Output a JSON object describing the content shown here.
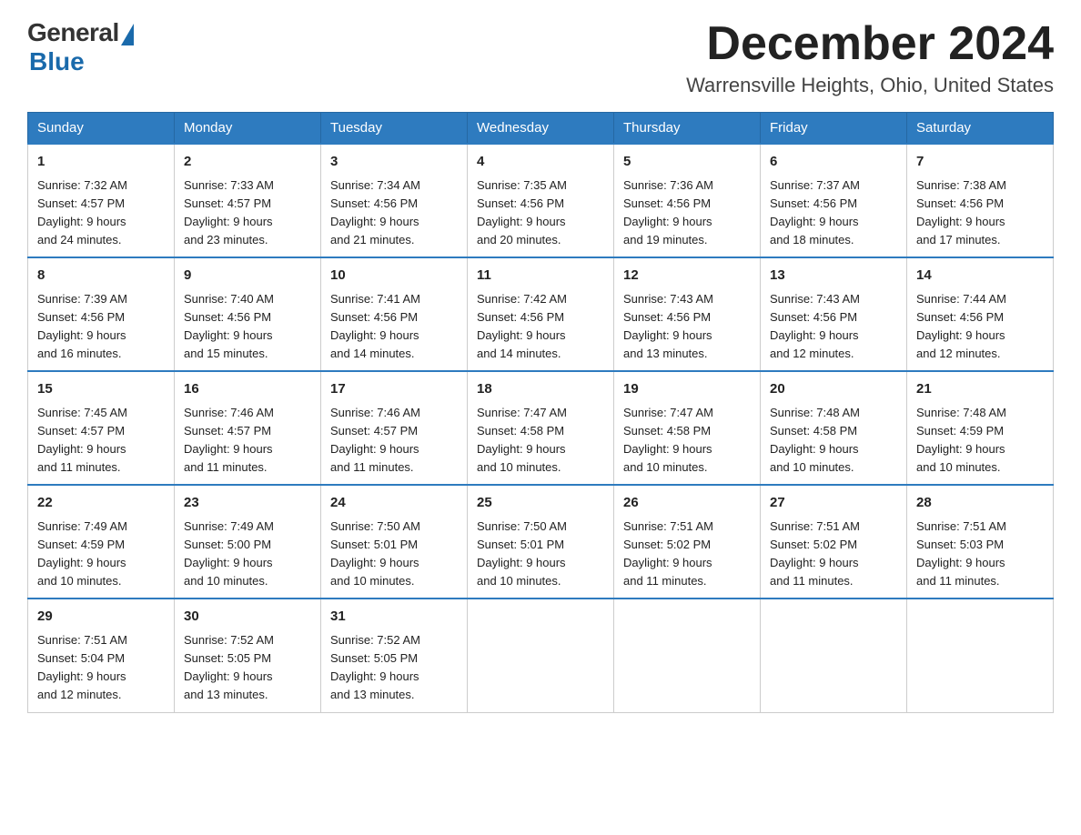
{
  "logo": {
    "general": "General",
    "blue": "Blue"
  },
  "title": "December 2024",
  "location": "Warrensville Heights, Ohio, United States",
  "days_of_week": [
    "Sunday",
    "Monday",
    "Tuesday",
    "Wednesday",
    "Thursday",
    "Friday",
    "Saturday"
  ],
  "weeks": [
    [
      {
        "day": "1",
        "sunrise": "7:32 AM",
        "sunset": "4:57 PM",
        "daylight": "9 hours and 24 minutes."
      },
      {
        "day": "2",
        "sunrise": "7:33 AM",
        "sunset": "4:57 PM",
        "daylight": "9 hours and 23 minutes."
      },
      {
        "day": "3",
        "sunrise": "7:34 AM",
        "sunset": "4:56 PM",
        "daylight": "9 hours and 21 minutes."
      },
      {
        "day": "4",
        "sunrise": "7:35 AM",
        "sunset": "4:56 PM",
        "daylight": "9 hours and 20 minutes."
      },
      {
        "day": "5",
        "sunrise": "7:36 AM",
        "sunset": "4:56 PM",
        "daylight": "9 hours and 19 minutes."
      },
      {
        "day": "6",
        "sunrise": "7:37 AM",
        "sunset": "4:56 PM",
        "daylight": "9 hours and 18 minutes."
      },
      {
        "day": "7",
        "sunrise": "7:38 AM",
        "sunset": "4:56 PM",
        "daylight": "9 hours and 17 minutes."
      }
    ],
    [
      {
        "day": "8",
        "sunrise": "7:39 AM",
        "sunset": "4:56 PM",
        "daylight": "9 hours and 16 minutes."
      },
      {
        "day": "9",
        "sunrise": "7:40 AM",
        "sunset": "4:56 PM",
        "daylight": "9 hours and 15 minutes."
      },
      {
        "day": "10",
        "sunrise": "7:41 AM",
        "sunset": "4:56 PM",
        "daylight": "9 hours and 14 minutes."
      },
      {
        "day": "11",
        "sunrise": "7:42 AM",
        "sunset": "4:56 PM",
        "daylight": "9 hours and 14 minutes."
      },
      {
        "day": "12",
        "sunrise": "7:43 AM",
        "sunset": "4:56 PM",
        "daylight": "9 hours and 13 minutes."
      },
      {
        "day": "13",
        "sunrise": "7:43 AM",
        "sunset": "4:56 PM",
        "daylight": "9 hours and 12 minutes."
      },
      {
        "day": "14",
        "sunrise": "7:44 AM",
        "sunset": "4:56 PM",
        "daylight": "9 hours and 12 minutes."
      }
    ],
    [
      {
        "day": "15",
        "sunrise": "7:45 AM",
        "sunset": "4:57 PM",
        "daylight": "9 hours and 11 minutes."
      },
      {
        "day": "16",
        "sunrise": "7:46 AM",
        "sunset": "4:57 PM",
        "daylight": "9 hours and 11 minutes."
      },
      {
        "day": "17",
        "sunrise": "7:46 AM",
        "sunset": "4:57 PM",
        "daylight": "9 hours and 11 minutes."
      },
      {
        "day": "18",
        "sunrise": "7:47 AM",
        "sunset": "4:58 PM",
        "daylight": "9 hours and 10 minutes."
      },
      {
        "day": "19",
        "sunrise": "7:47 AM",
        "sunset": "4:58 PM",
        "daylight": "9 hours and 10 minutes."
      },
      {
        "day": "20",
        "sunrise": "7:48 AM",
        "sunset": "4:58 PM",
        "daylight": "9 hours and 10 minutes."
      },
      {
        "day": "21",
        "sunrise": "7:48 AM",
        "sunset": "4:59 PM",
        "daylight": "9 hours and 10 minutes."
      }
    ],
    [
      {
        "day": "22",
        "sunrise": "7:49 AM",
        "sunset": "4:59 PM",
        "daylight": "9 hours and 10 minutes."
      },
      {
        "day": "23",
        "sunrise": "7:49 AM",
        "sunset": "5:00 PM",
        "daylight": "9 hours and 10 minutes."
      },
      {
        "day": "24",
        "sunrise": "7:50 AM",
        "sunset": "5:01 PM",
        "daylight": "9 hours and 10 minutes."
      },
      {
        "day": "25",
        "sunrise": "7:50 AM",
        "sunset": "5:01 PM",
        "daylight": "9 hours and 10 minutes."
      },
      {
        "day": "26",
        "sunrise": "7:51 AM",
        "sunset": "5:02 PM",
        "daylight": "9 hours and 11 minutes."
      },
      {
        "day": "27",
        "sunrise": "7:51 AM",
        "sunset": "5:02 PM",
        "daylight": "9 hours and 11 minutes."
      },
      {
        "day": "28",
        "sunrise": "7:51 AM",
        "sunset": "5:03 PM",
        "daylight": "9 hours and 11 minutes."
      }
    ],
    [
      {
        "day": "29",
        "sunrise": "7:51 AM",
        "sunset": "5:04 PM",
        "daylight": "9 hours and 12 minutes."
      },
      {
        "day": "30",
        "sunrise": "7:52 AM",
        "sunset": "5:05 PM",
        "daylight": "9 hours and 13 minutes."
      },
      {
        "day": "31",
        "sunrise": "7:52 AM",
        "sunset": "5:05 PM",
        "daylight": "9 hours and 13 minutes."
      },
      null,
      null,
      null,
      null
    ]
  ],
  "labels": {
    "sunrise": "Sunrise:",
    "sunset": "Sunset:",
    "daylight": "Daylight:"
  }
}
